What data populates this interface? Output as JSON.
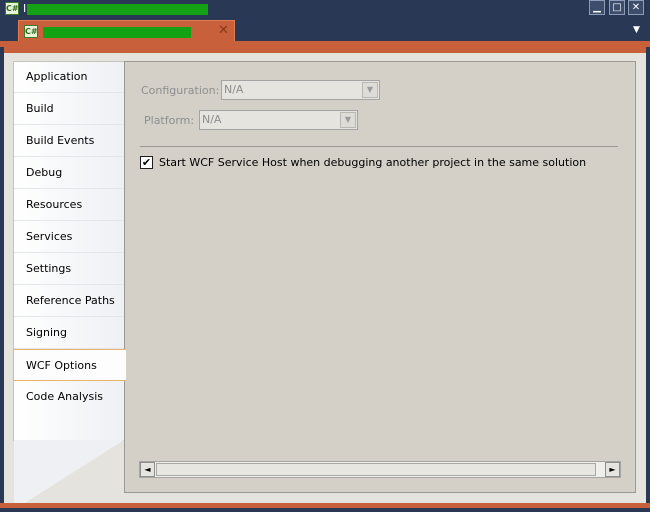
{
  "window": {
    "app_icon_text": "C#",
    "title": "I",
    "buttons": {
      "minimize": "▁",
      "maximize": "□",
      "close": "✕"
    }
  },
  "document_tab": {
    "icon_text": "C#",
    "close_glyph": "✕"
  },
  "tab_overflow_glyph": "▼",
  "nav": {
    "items": [
      {
        "label": "Application"
      },
      {
        "label": "Build"
      },
      {
        "label": "Build Events"
      },
      {
        "label": "Debug"
      },
      {
        "label": "Resources"
      },
      {
        "label": "Services"
      },
      {
        "label": "Settings"
      },
      {
        "label": "Reference Paths"
      },
      {
        "label": "Signing"
      },
      {
        "label": "WCF Options"
      },
      {
        "label": "Code Analysis"
      }
    ],
    "active": "WCF Options"
  },
  "wcf_options": {
    "configuration_label": "Configuration:",
    "configuration_value": "N/A",
    "platform_label": "Platform:",
    "platform_value": "N/A",
    "start_host_checked": true,
    "start_host_check_glyph": "✔",
    "start_host_label": "Start WCF Service Host when debugging another project in the same solution"
  },
  "scrollbar": {
    "left_arrow": "◄",
    "right_arrow": "►"
  },
  "colors": {
    "title_bar": "#293955",
    "tab_accent": "#c7603b",
    "content_bg": "#d4d0c8",
    "redaction": "#14a114"
  }
}
